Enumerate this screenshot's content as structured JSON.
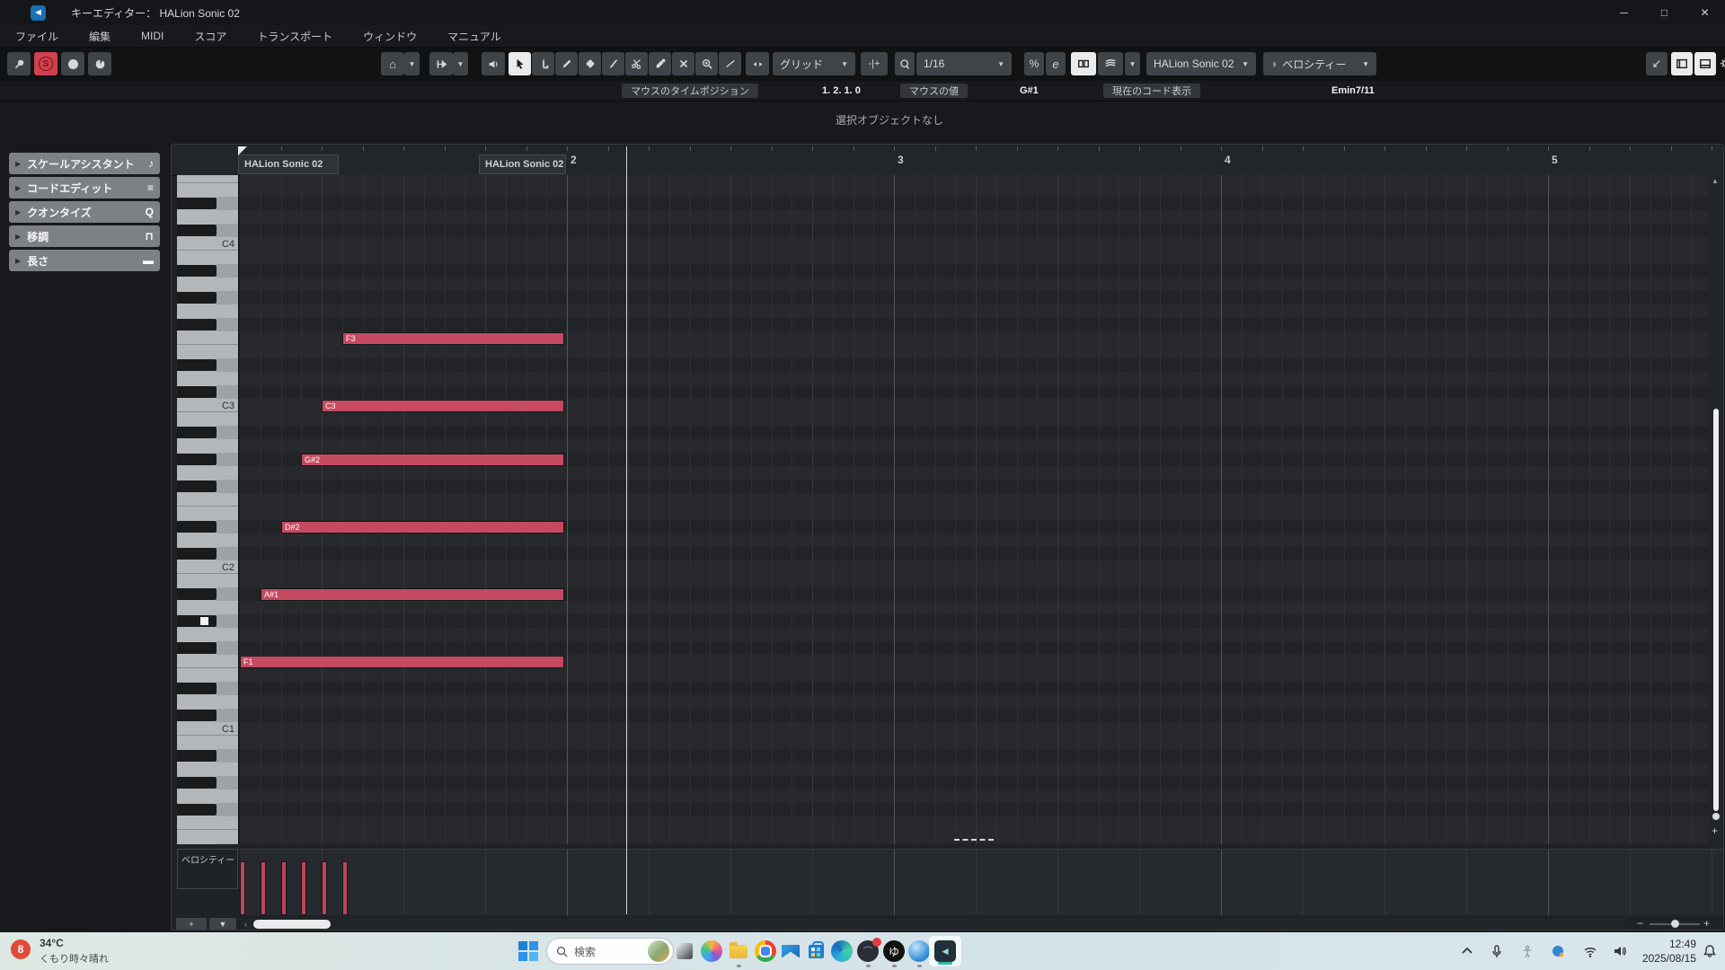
{
  "window": {
    "title": "キーエディター： HALion Sonic 02",
    "minimize": "─",
    "maximize": "□",
    "close": "✕"
  },
  "menu": {
    "items": [
      "ファイル",
      "編集",
      "MIDI",
      "スコア",
      "トランスポート",
      "ウィンドウ",
      "マニュアル"
    ]
  },
  "toolbar": {
    "grid_label": "グリッド",
    "quantize_value": "1/16",
    "track_selector": "HALion Sonic 02",
    "controller_selector": "ベロシティー",
    "mini_labels": {
      "home": "⌂",
      "nudge": "-|+",
      "iq": "%",
      "e": "e",
      "mute": "✕",
      "lowerzone": "↙"
    }
  },
  "info_line": {
    "mouse_time_label": "マウスのタイムポジション",
    "mouse_time_value": "1. 2. 1.  0",
    "mouse_value_label": "マウスの値",
    "mouse_value_value": "G#1",
    "chord_label": "現在のコード表示",
    "chord_value": "Emin7/11"
  },
  "status_line": "選択オブジェクトなし",
  "inspector": {
    "sections": [
      {
        "label": "スケールアシスタント",
        "icon": "scale-assistant-icon",
        "glyph": "♪"
      },
      {
        "label": "コードエディット",
        "icon": "chord-edit-icon",
        "glyph": "≡"
      },
      {
        "label": "クオンタイズ",
        "icon": "quantize-icon",
        "glyph": "Q"
      },
      {
        "label": "移調",
        "icon": "transpose-icon",
        "glyph": "⊓"
      },
      {
        "label": "長さ",
        "icon": "length-icon",
        "glyph": "▬"
      }
    ]
  },
  "ruler": {
    "part_labels": [
      "HALion Sonic 02",
      "HALion Sonic 02"
    ],
    "bar_numbers": [
      2,
      3,
      4,
      5
    ]
  },
  "keyboard": {
    "c_labels": [
      "C4",
      "C3",
      "C2",
      "C1"
    ],
    "mouse_key": "G#1"
  },
  "notes": [
    {
      "pitch": "F3",
      "step": 5
    },
    {
      "pitch": "C3",
      "step": 4
    },
    {
      "pitch": "G#2",
      "step": 3
    },
    {
      "pitch": "D#2",
      "step": 2
    },
    {
      "pitch": "A#1",
      "step": 1
    },
    {
      "pitch": "F1",
      "step": 0
    }
  ],
  "velocity": {
    "label": "ベロシティー"
  },
  "colors": {
    "note": "#c64a5f",
    "accent": "#2fb8a6",
    "solo": "#d0414e"
  },
  "taskbar": {
    "search_placeholder": "検索",
    "weather": {
      "badge": "8",
      "temp": "34°C",
      "condition": "くもり時々晴れ"
    },
    "clock": {
      "time": "12:49",
      "date": "2025/08/15"
    },
    "apps": [
      {
        "name": "start"
      },
      {
        "name": "taskview"
      },
      {
        "name": "copilot"
      },
      {
        "name": "explorer",
        "dot": true
      },
      {
        "name": "chrome"
      },
      {
        "name": "mail"
      },
      {
        "name": "store"
      },
      {
        "name": "edge"
      },
      {
        "name": "discord",
        "dot": true
      },
      {
        "name": "media",
        "dot": true,
        "glyph": "ゆ"
      },
      {
        "name": "sphere",
        "dot": true
      },
      {
        "name": "cubase",
        "active": true
      }
    ]
  }
}
